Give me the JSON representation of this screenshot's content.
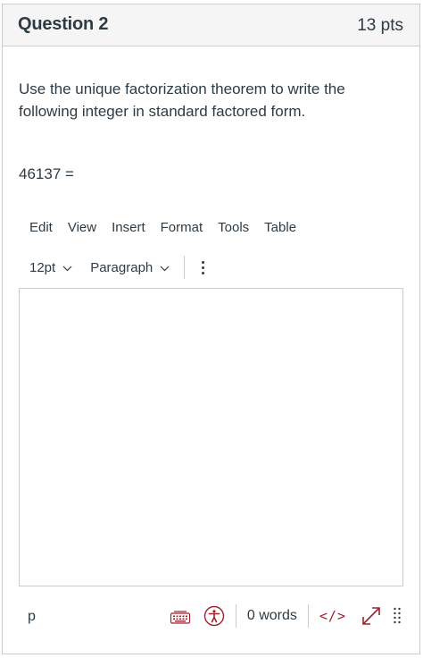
{
  "question": {
    "title": "Question 2",
    "points": "13 pts",
    "prompt": "Use the unique factorization theorem to write the following integer in standard factored form.",
    "equation": "46137 ="
  },
  "editor": {
    "menu": [
      "Edit",
      "View",
      "Insert",
      "Format",
      "Tools",
      "Table"
    ],
    "font_size": "12pt",
    "block_format": "Paragraph",
    "status_path": "p",
    "word_count": "0 words",
    "html_toggle": "</>",
    "accent_color": "#a0202e",
    "icons": [
      "keyboard-icon",
      "accessibility-icon",
      "fullscreen-icon",
      "resize-handle-icon",
      "more-options-icon",
      "chevron-down-icon"
    ]
  }
}
